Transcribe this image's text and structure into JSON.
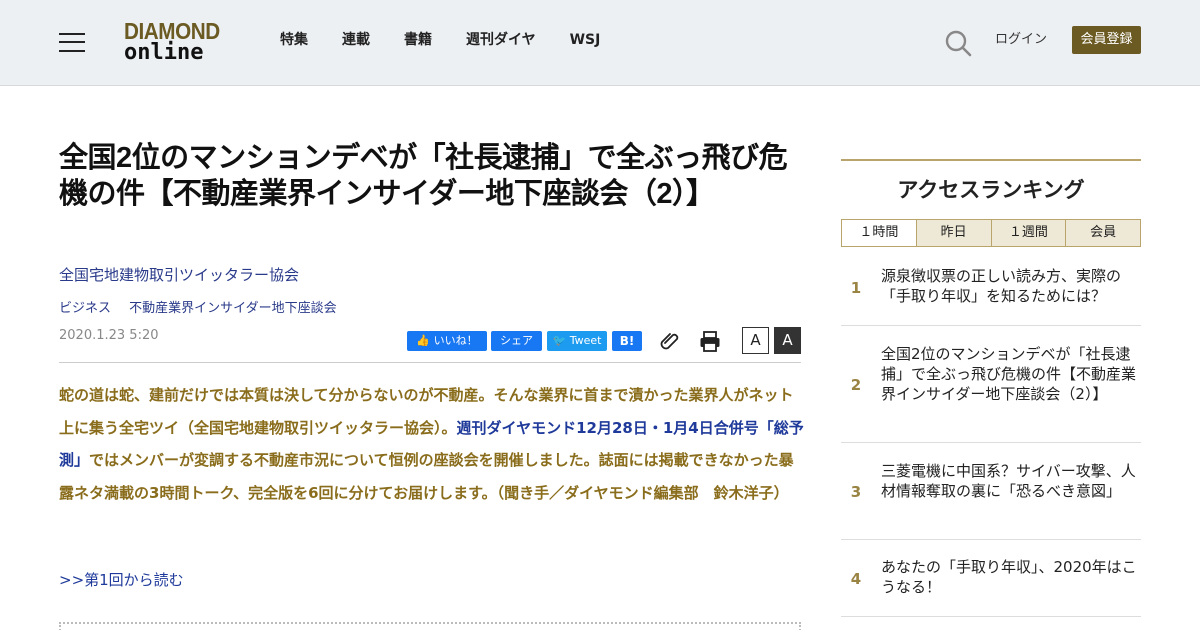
{
  "header": {
    "logo_line1": "DIAMOND",
    "logo_line2": "online",
    "nav": [
      "特集",
      "連載",
      "書籍",
      "週刊ダイヤ",
      "WSJ"
    ],
    "login": "ログイン",
    "register": "会員登録",
    "accent_color": "#6b5a22"
  },
  "article": {
    "title": "全国2位のマンションデベが「社長逮捕」で全ぶっ飛び危機の件【不動産業界インサイダー地下座談会（2）】",
    "author": "全国宅地建物取引ツイッタラー協会",
    "tags": [
      "ビジネス",
      "不動産業界インサイダー地下座談会"
    ],
    "date": "2020.1.23 5:20",
    "share": {
      "like": "いいね！",
      "share": "シェア",
      "tweet": "Tweet",
      "hatena": "B!"
    },
    "font_small": "A",
    "font_large": "A",
    "lead_part1": "蛇の道は蛇、建前だけでは本質は決して分からないのが不動産。そんな業界に首まで漬かった業界人がネット上に集う全宅ツイ（全国宅地建物取引ツイッタラー協会）。",
    "lead_link": "週刊ダイヤモンド12月28日・1月4日合併号「総予測」",
    "lead_part2": "ではメンバーが変調する不動産市況について恒例の座談会を開催しました。誌面には掲載できなかった暴露ネタ満載の3時間トーク、完全版を6回に分けてお届けします。（聞き手／ダイヤモンド編集部　鈴木洋子）",
    "read_first": ">>第1回から読む"
  },
  "ranking": {
    "title": "アクセスランキング",
    "tabs": [
      "１時間",
      "昨日",
      "１週間",
      "会員"
    ],
    "items": [
      {
        "rank": "1",
        "text": "源泉徴収票の正しい読み方、実際の「手取り年収」を知るためには？"
      },
      {
        "rank": "2",
        "text": "全国2位のマンションデベが「社長逮捕」で全ぶっ飛び危機の件【不動産業界インサイダー地下座談会（2）】"
      },
      {
        "rank": "3",
        "text": "三菱電機に中国系？サイバー攻撃、人材情報奪取の裏に「恐るべき意図」"
      },
      {
        "rank": "4",
        "text": "あなたの「手取り年収」、2020年はこうなる！"
      }
    ]
  }
}
